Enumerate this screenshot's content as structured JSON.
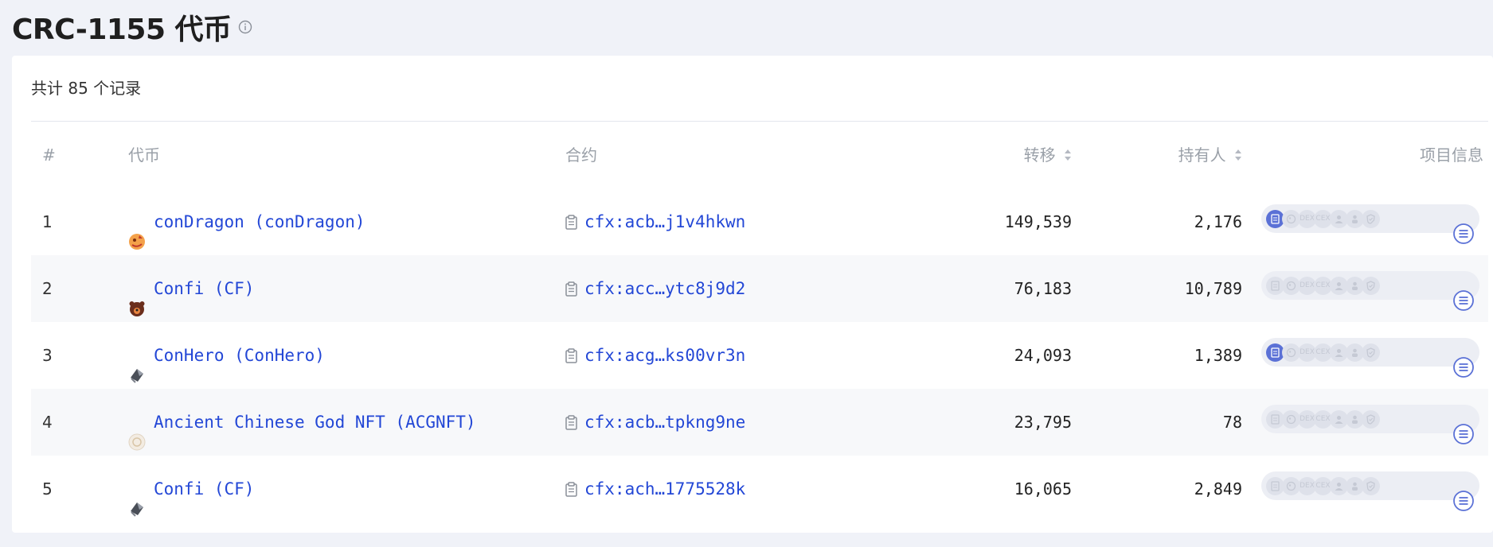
{
  "page": {
    "title": "CRC-1155 代币"
  },
  "summary": {
    "total": "共计 85 个记录"
  },
  "table": {
    "columns": {
      "index": "#",
      "token": "代币",
      "contract": "合约",
      "transfers": "转移",
      "holders": "持有人",
      "project": "项目信息"
    },
    "rows": [
      {
        "index": "1",
        "token": "conDragon (conDragon)",
        "logo": "dragon-logo-icon",
        "contract": "cfx:acb…j1v4hkwn",
        "transfers": "149,539",
        "holders": "2,176",
        "verified": true
      },
      {
        "index": "2",
        "token": "Confi (CF)",
        "logo": "bear-logo-icon",
        "contract": "cfx:acc…ytc8j9d2",
        "transfers": "76,183",
        "holders": "10,789",
        "verified": false
      },
      {
        "index": "3",
        "token": "ConHero (ConHero)",
        "logo": "hero-logo-icon",
        "contract": "cfx:acg…ks00vr3n",
        "transfers": "24,093",
        "holders": "1,389",
        "verified": true
      },
      {
        "index": "4",
        "token": "Ancient Chinese God NFT (ACGNFT)",
        "logo": "acgnft-logo-icon",
        "contract": "cfx:acb…tpkng9ne",
        "transfers": "23,795",
        "holders": "78",
        "verified": false
      },
      {
        "index": "5",
        "token": "Confi (CF)",
        "logo": "hero-logo-icon",
        "contract": "cfx:ach…1775528k",
        "transfers": "16,065",
        "holders": "2,849",
        "verified": false
      }
    ]
  },
  "project_badges": {
    "labels": [
      "",
      "",
      "DEX",
      "CEX",
      "",
      "",
      ""
    ],
    "icons": [
      "audit-icon",
      "coingecko-icon",
      "dex-icon",
      "cex-icon",
      "user-icon",
      "person-icon",
      "shield-icon"
    ]
  },
  "colors": {
    "link": "#2347d6",
    "badge_active": "#5b71d6",
    "background": "#f0f2f8"
  }
}
